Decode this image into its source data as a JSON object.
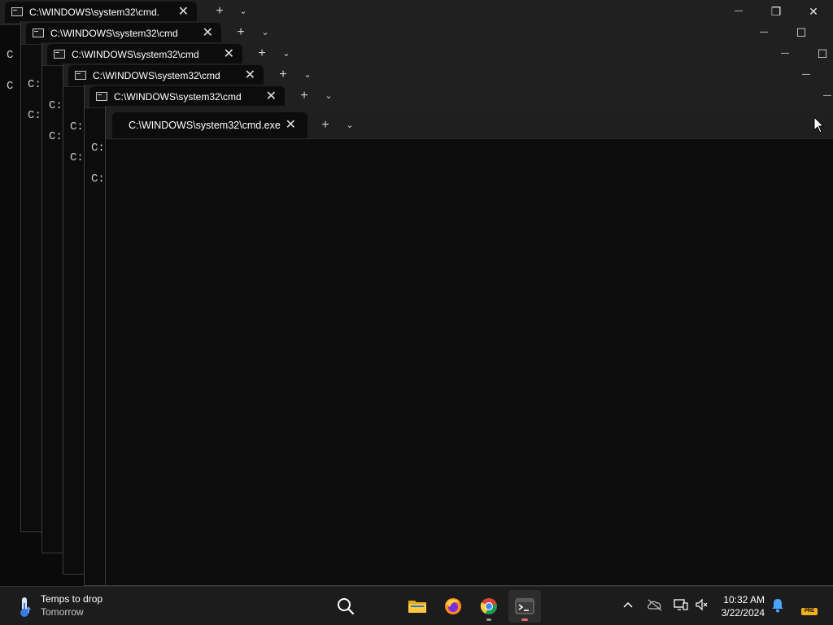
{
  "windows": [
    {
      "tab_title": "C:\\WINDOWS\\system32\\cmd.",
      "prompt": "C"
    },
    {
      "tab_title": "C:\\WINDOWS\\system32\\cmd",
      "prompt": "C:"
    },
    {
      "tab_title": "C:\\WINDOWS\\system32\\cmd",
      "prompt": "C:"
    },
    {
      "tab_title": "C:\\WINDOWS\\system32\\cmd",
      "prompt": "C:"
    },
    {
      "tab_title": "C:\\WINDOWS\\system32\\cmd",
      "prompt": "C:"
    },
    {
      "tab_title": "C:\\WINDOWS\\system32\\cmd.exe",
      "prompt": ""
    }
  ],
  "controls": {
    "new_tab": "+",
    "dropdown": "⌄",
    "close": "✕",
    "minimize": "—",
    "maximize": "☐",
    "restore": "❐"
  },
  "taskbar": {
    "weather_title": "Temps to drop",
    "weather_subtitle": "Tomorrow",
    "time": "10:32 AM",
    "date": "3/22/2024",
    "tray_badge": "PRE",
    "apps": [
      "search",
      "file-explorer",
      "firefox",
      "chrome",
      "terminal"
    ]
  },
  "colors": {
    "terminal_bg": "#0c0c0c",
    "titlebar": "#202020",
    "taskbar": "#1c1c1c",
    "running_active": "#e26a6a"
  }
}
